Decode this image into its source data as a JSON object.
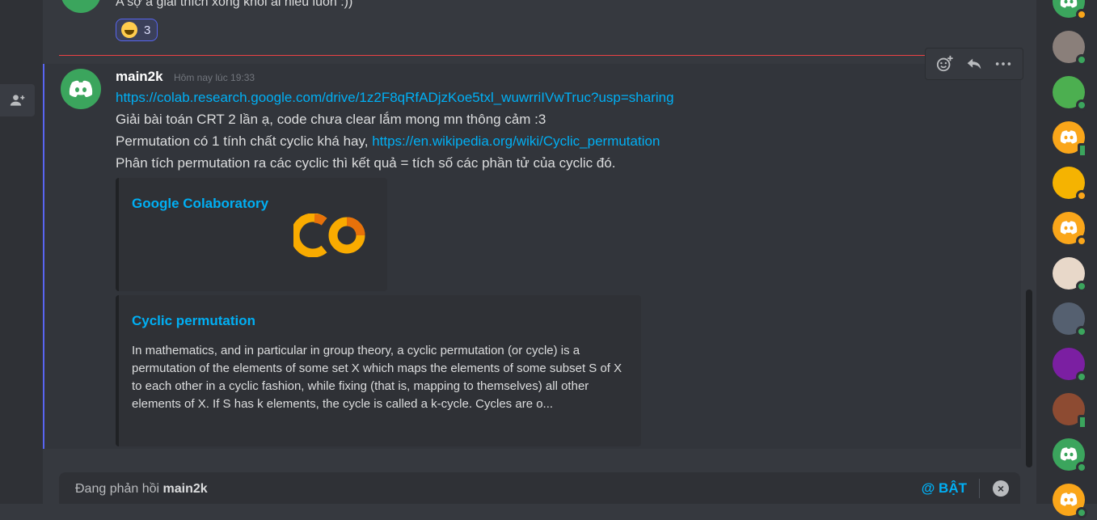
{
  "prev_message": {
    "text": "A sợ a giải thích xong khỏi ai hiểu luôn :))",
    "reaction_count": "3"
  },
  "message": {
    "author": "main2k",
    "timestamp": "Hôm nay lúc 19:33",
    "link1": "https://colab.research.google.com/drive/1z2F8qRfADjzKoe5txl_wuwrriIVwTruc?usp=sharing",
    "line2": "Giải bài toán CRT 2 lần ạ, code chưa clear lắm mong mn thông cảm :3",
    "line3_prefix": "Permutation có 1 tính chất cyclic khá hay,",
    "link2": "https://en.wikipedia.org/wiki/Cyclic_permutation",
    "line4": "Phân tích permutation ra các cyclic thì kết quả = tích số các phần tử của cyclic đó.",
    "embed1_title": "Google Colaboratory",
    "embed2_title": "Cyclic permutation",
    "embed2_desc": "In mathematics, and in particular in group theory, a cyclic permutation (or cycle) is a permutation of the elements of some set X which maps the elements of some subset S of X to each other in a cyclic fashion, while fixing (that is, mapping to themselves) all other elements of X. If S has k elements, the cycle is called a k-cycle. Cycles are o..."
  },
  "reply_bar": {
    "prefix": "Đang phản hồi",
    "username": "main2k",
    "mention_label": "BẬT",
    "mention_symbol": "@"
  },
  "colors": {
    "accent": "#5865f2",
    "link": "#00aff4",
    "online": "#3ba55d",
    "idle": "#faa61a",
    "divider": "#ed4245"
  },
  "members": [
    {
      "avatar": "discord-default-green",
      "status": "idle"
    },
    {
      "avatar": "photo-man",
      "status": "online"
    },
    {
      "avatar": "pepe-clown",
      "status": "online"
    },
    {
      "avatar": "discord-default-orange",
      "status": "mobile"
    },
    {
      "avatar": "emoji-face",
      "status": "idle"
    },
    {
      "avatar": "discord-default-orange",
      "status": "idle"
    },
    {
      "avatar": "anime-girl",
      "status": "online"
    },
    {
      "avatar": "photo-man-2",
      "status": "online"
    },
    {
      "avatar": "purple-cat",
      "status": "online"
    },
    {
      "avatar": "anime-boy",
      "status": "mobile"
    },
    {
      "avatar": "discord-default-green",
      "status": "online"
    },
    {
      "avatar": "discord-default-orange",
      "status": "online"
    }
  ]
}
